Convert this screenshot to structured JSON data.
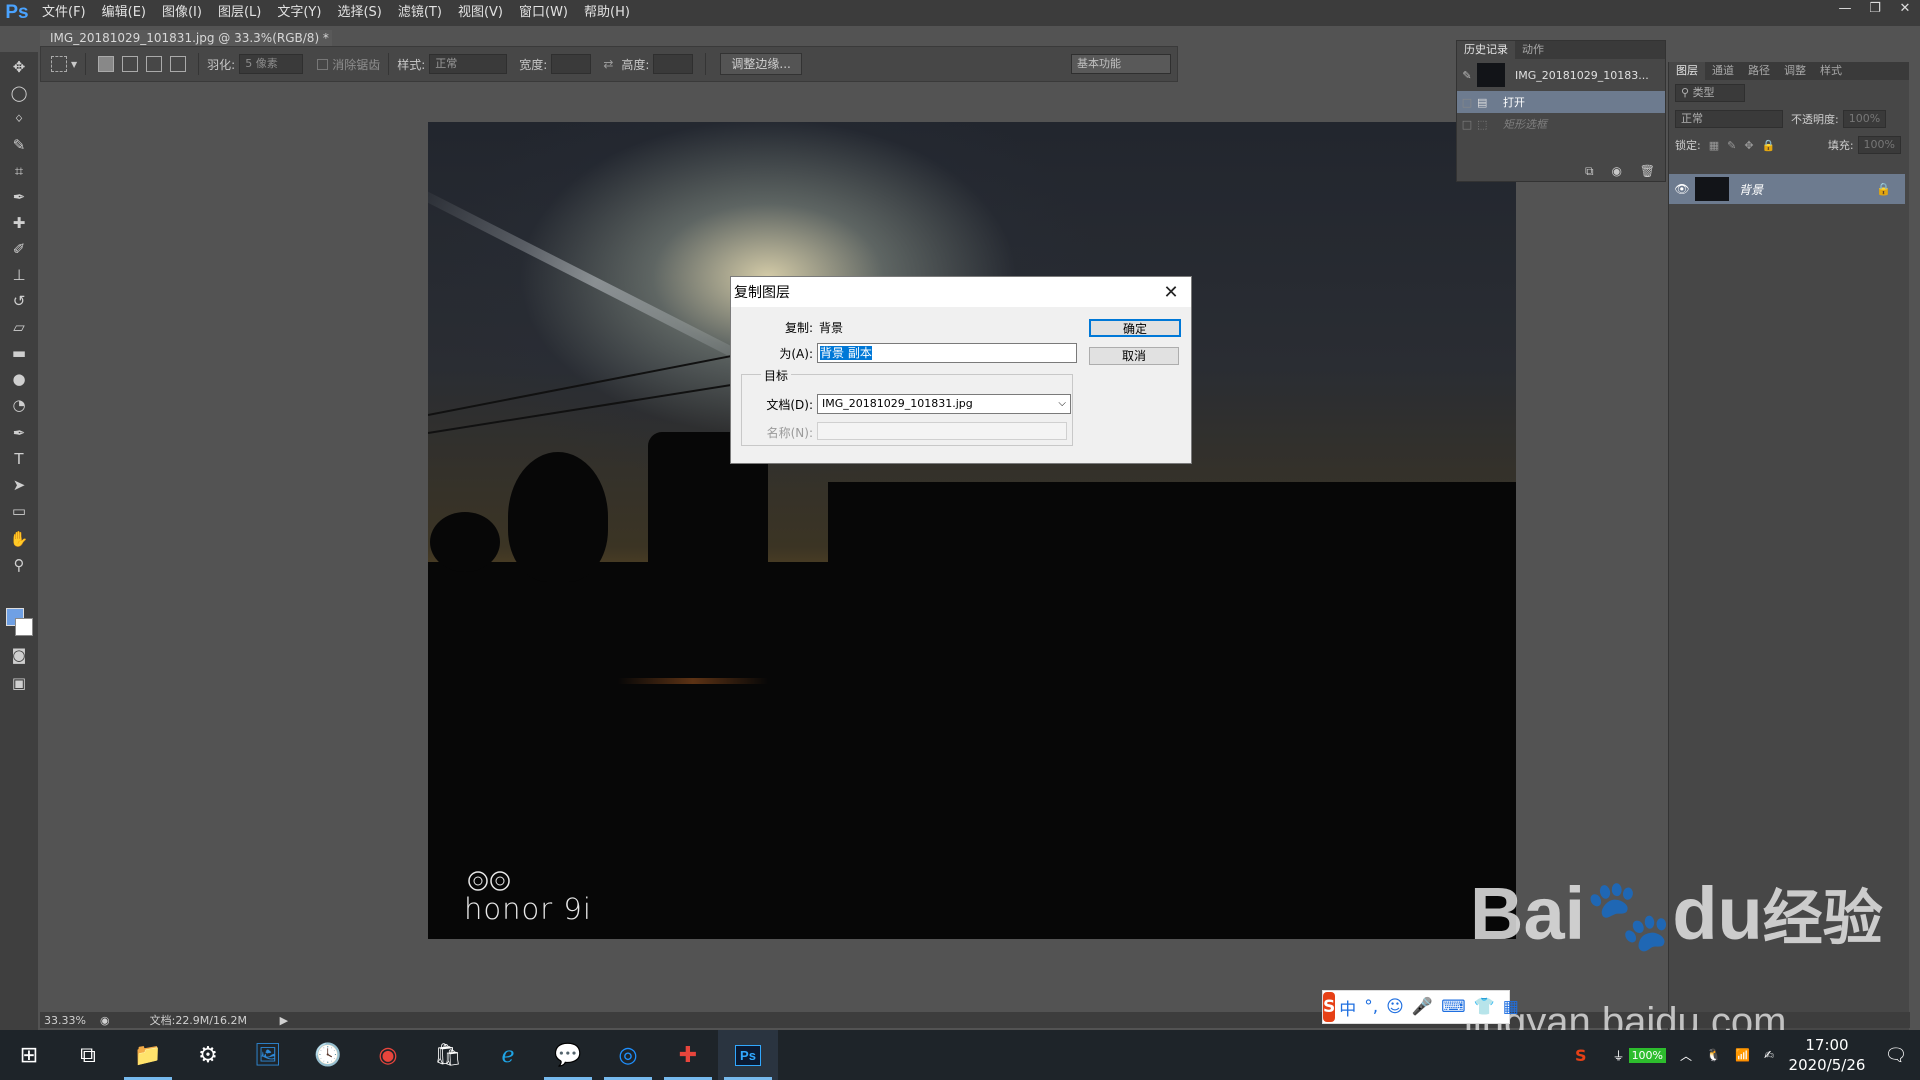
{
  "app": {
    "logo": "Ps",
    "menu": [
      "文件(F)",
      "编辑(E)",
      "图像(I)",
      "图层(L)",
      "文字(Y)",
      "选择(S)",
      "滤镜(T)",
      "视图(V)",
      "窗口(W)",
      "帮助(H)"
    ],
    "window_controls": [
      "—",
      "❐",
      "✕"
    ]
  },
  "document_tab": {
    "title": "IMG_20181029_101831.jpg @ 33.3%(RGB/8) *",
    "close": "×"
  },
  "options_bar": {
    "feather_label": "羽化:",
    "feather_value": "5 像素",
    "antialias_label": "消除锯齿",
    "style_label": "样式:",
    "style_value": "正常",
    "width_label": "宽度:",
    "height_label": "高度:",
    "refine_button": "调整边缘...",
    "workspace": "基本功能"
  },
  "history_panel": {
    "tabs": [
      "历史记录",
      "动作"
    ],
    "snapshot": "IMG_20181029_10183...",
    "items": [
      "打开",
      "矩形选框"
    ]
  },
  "layers_panel": {
    "tabs": [
      "图层",
      "通道",
      "路径",
      "调整",
      "样式"
    ],
    "filter_kind": "类型",
    "blend_mode": "正常",
    "opacity_label": "不透明度:",
    "opacity_value": "100%",
    "lock_label": "锁定:",
    "fill_label": "填充:",
    "fill_value": "100%",
    "layer_name": "背景"
  },
  "canvas": {
    "watermark": "honor 9i"
  },
  "status_bar": {
    "zoom": "33.33%",
    "doc_info": "文档:22.9M/16.2M"
  },
  "dialog": {
    "title": "复制图层",
    "copy_label": "复制:",
    "copy_value": "背景",
    "as_label": "为(A):",
    "as_value": "背景 副本",
    "group_label": "目标",
    "doc_label": "文档(D):",
    "doc_value": "IMG_20181029_101831.jpg",
    "name_label": "名称(N):",
    "ok": "确定",
    "cancel": "取消"
  },
  "watermark": {
    "brand": "Bai",
    "brand2": "du",
    "brand_cn": "经验",
    "url": "jingyan.baidu.com"
  },
  "ime": {
    "logo": "S",
    "mode": "中"
  },
  "taskbar": {
    "apps": [
      "start",
      "task-view",
      "file-explorer",
      "settings",
      "photos",
      "clock-app",
      "chrome",
      "store",
      "ie",
      "wechat",
      "qq-browser",
      "color-app",
      "photoshop"
    ],
    "battery": "100%",
    "time": "17:00",
    "date": "2020/5/26"
  }
}
